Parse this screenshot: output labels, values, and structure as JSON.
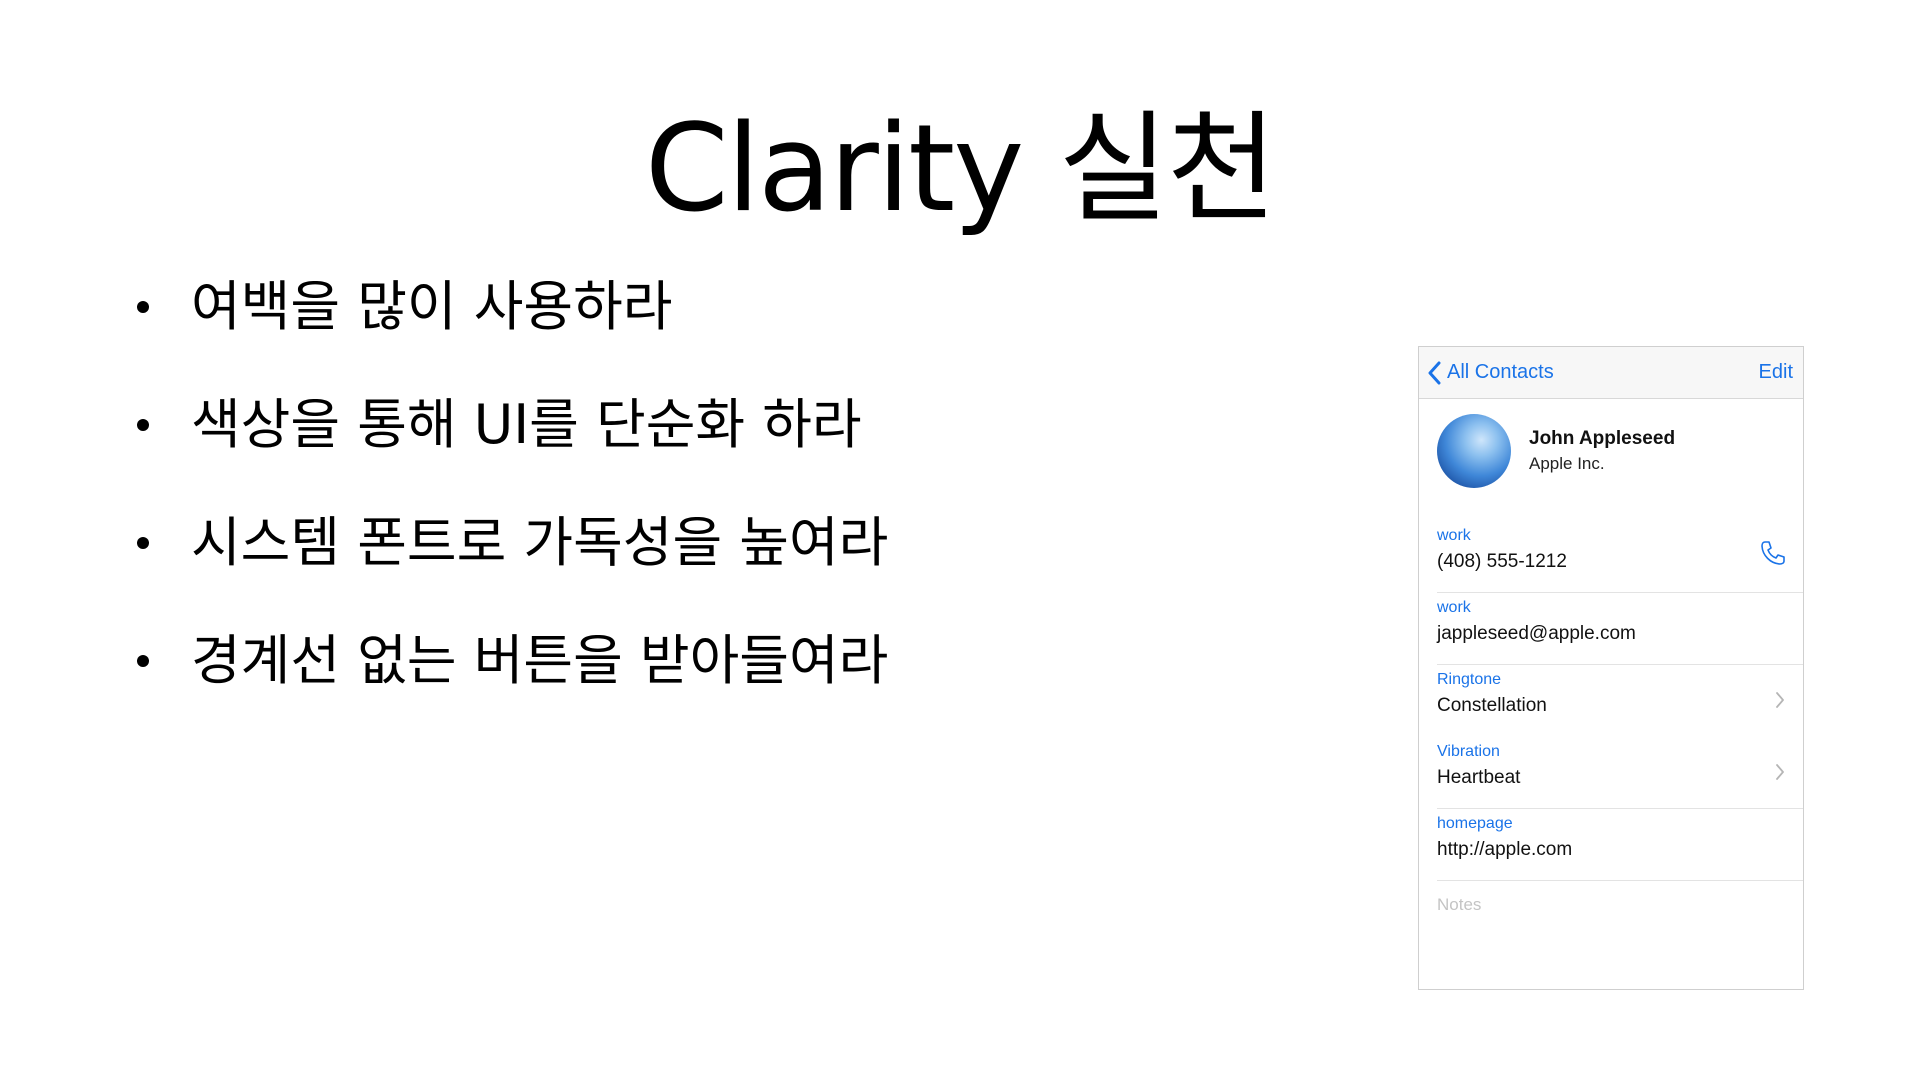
{
  "slide": {
    "title": "Clarity 실천",
    "bullets": [
      "여백을 많이 사용하라",
      "색상을 통해 UI를 단순화 하라",
      "시스템 폰트로 가독성을 높여라",
      "경계선 없는 버튼을 받아들여라"
    ]
  },
  "contact_card": {
    "nav": {
      "back_label": "All Contacts",
      "edit_label": "Edit"
    },
    "name": "John Appleseed",
    "company": "Apple Inc.",
    "fields": [
      {
        "label": "work",
        "value": "(408) 555-1212"
      },
      {
        "label": "work",
        "value": "jappleseed@apple.com"
      },
      {
        "label": "Ringtone",
        "value": "Constellation"
      },
      {
        "label": "Vibration",
        "value": "Heartbeat"
      },
      {
        "label": "homepage",
        "value": "http://apple.com"
      }
    ],
    "notes_placeholder": "Notes",
    "accent_color": "#1a73e8",
    "icons": {
      "back": "chevron-left-icon",
      "phone": "phone-icon",
      "disclosure": "chevron-right-icon"
    }
  }
}
